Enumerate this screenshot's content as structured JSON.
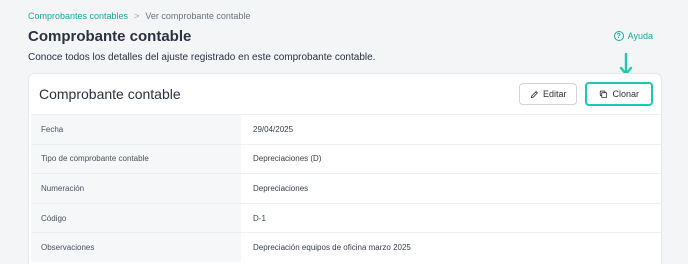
{
  "breadcrumb": {
    "parent": "Comprobantes contables",
    "separator": ">",
    "current": "Ver comprobante contable"
  },
  "page": {
    "title": "Comprobante contable",
    "subtitle": "Conoce todos los detalles del ajuste registrado en este comprobante contable.",
    "help_label": "Ayuda",
    "help_icon": "?"
  },
  "card": {
    "title": "Comprobante contable",
    "edit_label": "Editar",
    "clone_label": "Clonar"
  },
  "details": [
    {
      "label": "Fecha",
      "value": "29/04/2025"
    },
    {
      "label": "Tipo de comprobante contable",
      "value": "Depreciaciones (D)"
    },
    {
      "label": "Numeración",
      "value": "Depreciaciones"
    },
    {
      "label": "Código",
      "value": "D-1"
    },
    {
      "label": "Observaciones",
      "value": "Depreciación equipos de oficina marzo 2025"
    }
  ],
  "colors": {
    "accent": "#1aa89a",
    "highlight": "#1fc7b0"
  }
}
